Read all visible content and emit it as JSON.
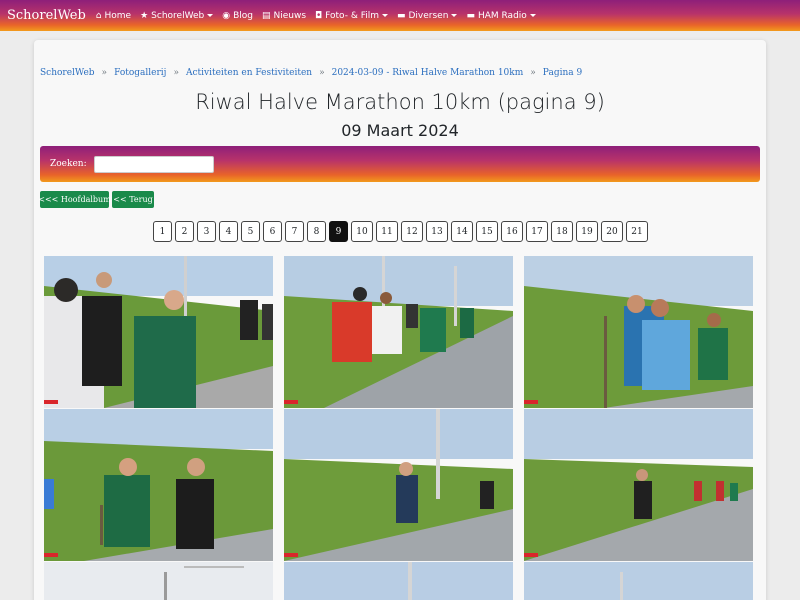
{
  "navbar": {
    "brand": "SchorelWeb",
    "items": [
      {
        "label": "Home",
        "icon": "home-icon",
        "dropdown": false
      },
      {
        "label": "SchorelWeb",
        "icon": "star-icon",
        "dropdown": true
      },
      {
        "label": "Blog",
        "icon": "rss-icon",
        "dropdown": false
      },
      {
        "label": "Nieuws",
        "icon": "newspaper-icon",
        "dropdown": false
      },
      {
        "label": "Foto- & Film",
        "icon": "camera-icon",
        "dropdown": true
      },
      {
        "label": "Diversen",
        "icon": "folder-icon",
        "dropdown": true
      },
      {
        "label": "HAM Radio",
        "icon": "folder-icon",
        "dropdown": true
      }
    ]
  },
  "breadcrumb": [
    "SchorelWeb",
    "Fotogallerij",
    "Activiteiten en Festiviteiten",
    "2024-03-09 - Riwal Halve Marathon 10km",
    "Pagina 9"
  ],
  "page": {
    "title": "Riwal Halve Marathon 10km (pagina 9)",
    "subtitle": "09 Maart 2024"
  },
  "search": {
    "label": "Zoeken:",
    "value": ""
  },
  "buttons": {
    "main_album": "<<< Hoofdalbum",
    "back": "<< Terug"
  },
  "pagination": {
    "pages": [
      "1",
      "2",
      "3",
      "4",
      "5",
      "6",
      "7",
      "8",
      "9",
      "10",
      "11",
      "12",
      "13",
      "14",
      "15",
      "16",
      "17",
      "18",
      "19",
      "20",
      "21"
    ],
    "current": "9"
  },
  "colors": {
    "gradient_start": "#8e1f7a",
    "gradient_end": "#f29a1c",
    "button_green": "#1a8a4a",
    "link_blue": "#2c6fbf"
  }
}
